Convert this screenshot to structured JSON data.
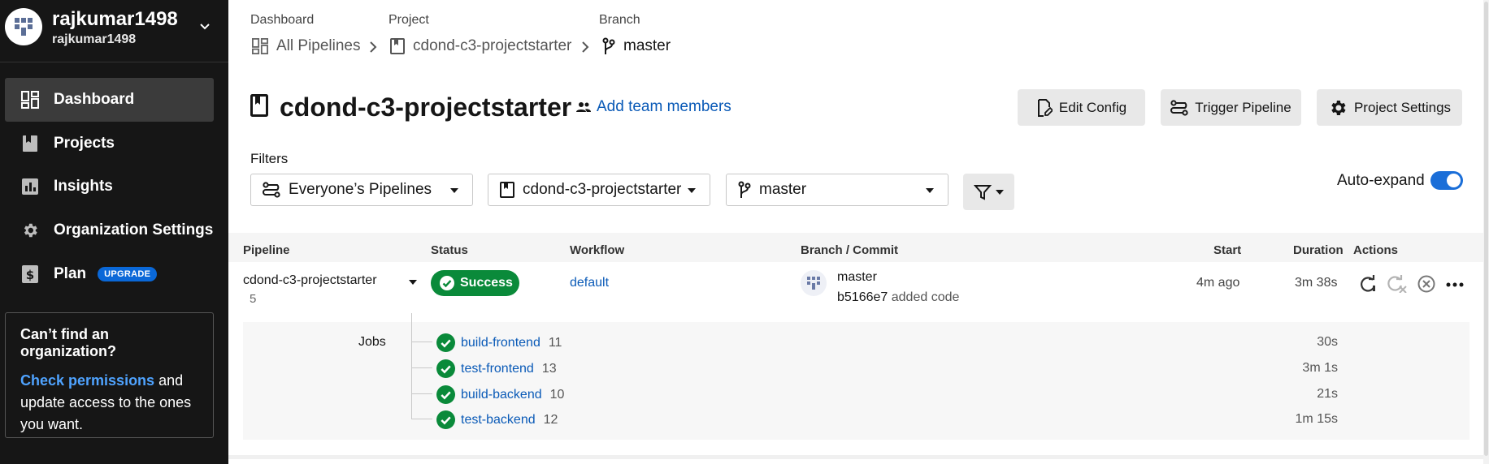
{
  "user": {
    "name": "rajkumar1498",
    "org": "rajkumar1498"
  },
  "sidebar": {
    "items": [
      {
        "label": "Dashboard",
        "icon": "dashboard-icon",
        "active": true
      },
      {
        "label": "Projects",
        "icon": "bookmark-icon"
      },
      {
        "label": "Insights",
        "icon": "bar-chart-icon"
      },
      {
        "label": "Organization Settings",
        "icon": "gear-icon"
      },
      {
        "label": "Plan",
        "icon": "dollar-icon",
        "badge": "UPGRADE"
      }
    ],
    "help": {
      "title": "Can’t find an organization?",
      "link": "Check permissions",
      "rest": " and update access to the ones you want."
    }
  },
  "breadcrumbs": [
    {
      "label": "Dashboard",
      "value": "All Pipelines"
    },
    {
      "label": "Project",
      "value": "cdond-c3-projectstarter"
    },
    {
      "label": "Branch",
      "value": "master"
    }
  ],
  "header": {
    "title": "cdond-c3-projectstarter",
    "team_link": "Add team members",
    "buttons": {
      "edit_config": "Edit Config",
      "trigger": "Trigger Pipeline",
      "settings": "Project Settings"
    }
  },
  "filters": {
    "label": "Filters",
    "pipelines": "Everyone’s Pipelines",
    "project": "cdond-c3-projectstarter",
    "branch": "master",
    "auto_expand_label": "Auto-expand",
    "auto_expand": true
  },
  "table": {
    "columns": {
      "pipeline": "Pipeline",
      "status": "Status",
      "workflow": "Workflow",
      "branch_commit": "Branch / Commit",
      "start": "Start",
      "duration": "Duration",
      "actions": "Actions"
    },
    "row": {
      "pipeline": "cdond-c3-projectstarter",
      "number": "5",
      "status": "Success",
      "workflow": "default",
      "branch": "master",
      "commit_hash": "b5166e7",
      "commit_msg": "added code",
      "start": "4m ago",
      "duration": "3m 38s"
    },
    "jobs_label": "Jobs",
    "jobs": [
      {
        "name": "build-frontend",
        "num": "11",
        "duration": "30s"
      },
      {
        "name": "test-frontend",
        "num": "13",
        "duration": "3m 1s"
      },
      {
        "name": "build-backend",
        "num": "10",
        "duration": "21s"
      },
      {
        "name": "test-backend",
        "num": "12",
        "duration": "1m 15s"
      }
    ]
  },
  "colors": {
    "sidebar_bg": "#161616",
    "success": "#0a8a3a",
    "link": "#0a5ab7",
    "toggle": "#1a6ed8",
    "badge": "#0a68d8"
  }
}
